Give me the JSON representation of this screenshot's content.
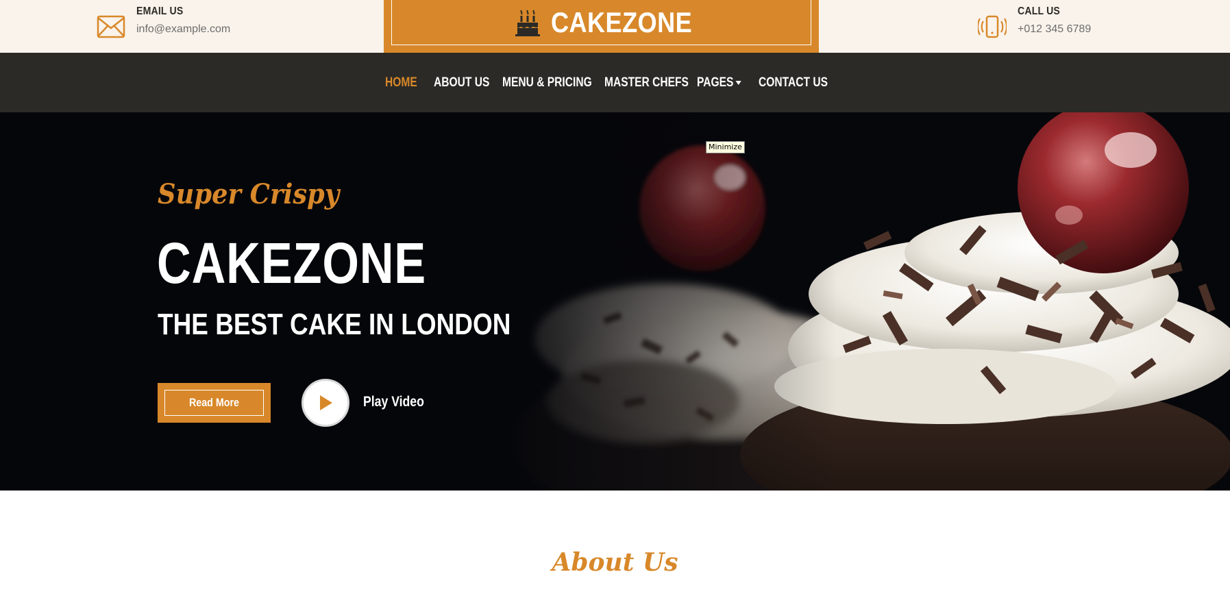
{
  "topbar": {
    "email": {
      "label": "EMAIL US",
      "value": "info@example.com",
      "icon": "envelope-icon"
    },
    "phone": {
      "label": "CALL US",
      "value": "+012 345 6789",
      "icon": "phone-icon"
    },
    "brand": {
      "name": "CAKEZONE",
      "icon": "birthday-cake-icon"
    }
  },
  "nav": {
    "items": [
      {
        "label": "HOME",
        "active": true
      },
      {
        "label": "ABOUT US"
      },
      {
        "label": "MENU & PRICING"
      },
      {
        "label": "MASTER CHEFS"
      },
      {
        "label": "PAGES"
      },
      {
        "label": "CONTACT US"
      }
    ]
  },
  "hero": {
    "tagline": "Super Crispy",
    "title": "CAKEZONE",
    "subtitle": "THE BEST CAKE IN LONDON",
    "read_more": "Read More",
    "play_label": "Play Video",
    "tooltip": "Minimize"
  },
  "about": {
    "heading": "About Us"
  },
  "colors": {
    "accent": "#d8882a",
    "dark": "#2b2a26",
    "cream": "#faf3eb"
  }
}
